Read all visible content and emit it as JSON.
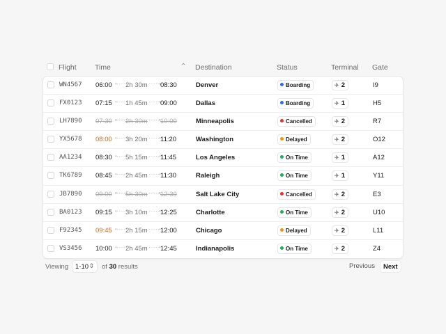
{
  "table": {
    "headers": {
      "flight": "Flight",
      "time": "Time",
      "destination": "Destination",
      "status": "Status",
      "terminal": "Terminal",
      "gate": "Gate"
    },
    "rows": [
      {
        "flight": "WN4567",
        "dep": "06:00",
        "duration": "2h 30m",
        "arr": "08:30",
        "destination": "Denver",
        "status": "Boarding",
        "terminal": "2",
        "gate": "I9"
      },
      {
        "flight": "FX0123",
        "dep": "07:15",
        "duration": "1h 45m",
        "arr": "09:00",
        "destination": "Dallas",
        "status": "Boarding",
        "terminal": "1",
        "gate": "H5"
      },
      {
        "flight": "LH7890",
        "dep": "07:30",
        "duration": "2h 30m",
        "arr": "10:00",
        "destination": "Minneapolis",
        "status": "Cancelled",
        "terminal": "2",
        "gate": "R7"
      },
      {
        "flight": "YX5678",
        "dep": "08:00",
        "duration": "3h 20m",
        "arr": "11:20",
        "destination": "Washington",
        "status": "Delayed",
        "terminal": "2",
        "gate": "O12"
      },
      {
        "flight": "AA1234",
        "dep": "08:30",
        "duration": "5h 15m",
        "arr": "11:45",
        "destination": "Los Angeles",
        "status": "On Time",
        "terminal": "1",
        "gate": "A12"
      },
      {
        "flight": "TK6789",
        "dep": "08:45",
        "duration": "2h 45m",
        "arr": "11:30",
        "destination": "Raleigh",
        "status": "On Time",
        "terminal": "1",
        "gate": "Y11"
      },
      {
        "flight": "JB7890",
        "dep": "09:00",
        "duration": "5h 30m",
        "arr": "12:30",
        "destination": "Salt Lake City",
        "status": "Cancelled",
        "terminal": "2",
        "gate": "E3"
      },
      {
        "flight": "BA0123",
        "dep": "09:15",
        "duration": "3h 10m",
        "arr": "12:25",
        "destination": "Charlotte",
        "status": "On Time",
        "terminal": "2",
        "gate": "U10"
      },
      {
        "flight": "F92345",
        "dep": "09:45",
        "duration": "2h 15m",
        "arr": "12:00",
        "destination": "Chicago",
        "status": "Delayed",
        "terminal": "2",
        "gate": "L11"
      },
      {
        "flight": "VS3456",
        "dep": "10:00",
        "duration": "2h 45m",
        "arr": "12:45",
        "destination": "Indianapolis",
        "status": "On Time",
        "terminal": "2",
        "gate": "Z4"
      }
    ]
  },
  "status_colors": {
    "Boarding": "#2f6fe4",
    "Cancelled": "#e03434",
    "Delayed": "#f0930f",
    "On Time": "#1fae5b"
  },
  "delayed_time_color": "#cc6a16",
  "icons": {
    "sort": "chevron-up-icon",
    "terminal": "plane-takeoff-icon",
    "page_size": "chevron-up-down-icon"
  },
  "footer": {
    "viewing_label": "Viewing",
    "page_size": "1-10",
    "of_label": "of",
    "total": "30",
    "results_label": "results",
    "previous_label": "Previous",
    "next_label": "Next"
  }
}
